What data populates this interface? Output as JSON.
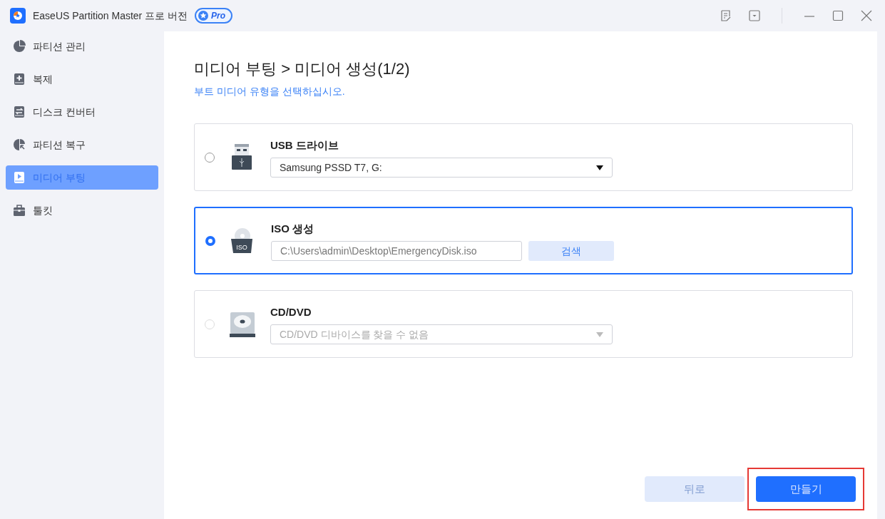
{
  "window": {
    "title": "EaseUS Partition Master 프로 버전",
    "badge": "Pro"
  },
  "sidebar": {
    "items": [
      {
        "label": "파티션 관리",
        "kind": "pie",
        "selected": false
      },
      {
        "label": "복제",
        "kind": "clone",
        "selected": false
      },
      {
        "label": "디스크 컨버터",
        "kind": "convert",
        "selected": false
      },
      {
        "label": "파티션 복구",
        "kind": "recover",
        "selected": false
      },
      {
        "label": "미디어 부팅",
        "kind": "media",
        "selected": true
      },
      {
        "label": "툴킷",
        "kind": "toolkit",
        "selected": false
      }
    ]
  },
  "page": {
    "breadcrumb": "미디어 부팅 > 미디어 생성(1/2)",
    "subtitle": "부트 미디어 유형을 선택하십시오."
  },
  "options": [
    {
      "kind": "usb",
      "title": "USB 드라이브",
      "selected": false,
      "disabled": false,
      "field": {
        "kind": "dropdown",
        "value": "Samsung PSSD T7, G:"
      }
    },
    {
      "kind": "iso",
      "title": "ISO 생성",
      "icon_label": "ISO",
      "selected": true,
      "disabled": false,
      "field": {
        "kind": "path",
        "value": "C:\\Users\\admin\\Desktop\\EmergencyDisk.iso",
        "button": "검색"
      }
    },
    {
      "kind": "cd",
      "title": "CD/DVD",
      "selected": false,
      "disabled": true,
      "field": {
        "kind": "dropdown",
        "value": "CD/DVD 디바이스를 찾을 수 없음"
      }
    }
  ],
  "buttons": [
    {
      "label": "뒤로",
      "kind": "secondary",
      "highlighted": false
    },
    {
      "label": "만들기",
      "kind": "primary",
      "highlighted": true
    }
  ]
}
